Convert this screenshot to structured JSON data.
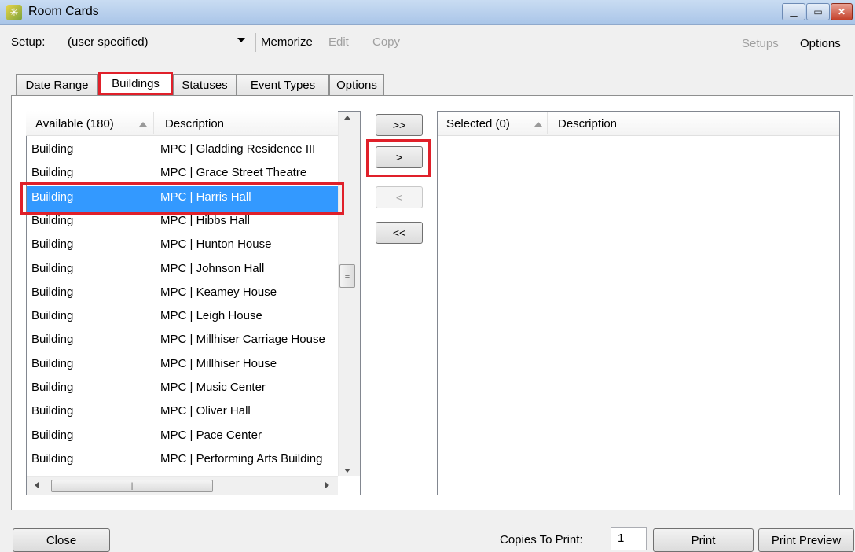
{
  "window": {
    "title": "Room Cards"
  },
  "toolbar": {
    "setup_label": "Setup:",
    "setup_value": "(user specified)",
    "memorize": "Memorize",
    "edit": "Edit",
    "copy": "Copy",
    "setups": "Setups",
    "options": "Options"
  },
  "tabs": [
    {
      "label": "Date Range"
    },
    {
      "label": "Buildings",
      "active": true
    },
    {
      "label": "Statuses"
    },
    {
      "label": "Event Types"
    },
    {
      "label": "Options"
    }
  ],
  "available": {
    "header_col1": "Available (180)",
    "header_col2": "Description",
    "rows": [
      {
        "type": "Building",
        "desc": "MPC | Gladding Residence III"
      },
      {
        "type": "Building",
        "desc": "MPC | Grace Street Theatre"
      },
      {
        "type": "Building",
        "desc": "MPC | Harris Hall",
        "selected": true
      },
      {
        "type": "Building",
        "desc": "MPC | Hibbs Hall"
      },
      {
        "type": "Building",
        "desc": "MPC | Hunton House"
      },
      {
        "type": "Building",
        "desc": "MPC | Johnson Hall"
      },
      {
        "type": "Building",
        "desc": "MPC | Keamey House"
      },
      {
        "type": "Building",
        "desc": "MPC | Leigh House"
      },
      {
        "type": "Building",
        "desc": "MPC | Millhiser Carriage House"
      },
      {
        "type": "Building",
        "desc": "MPC | Millhiser House"
      },
      {
        "type": "Building",
        "desc": "MPC | Music Center"
      },
      {
        "type": "Building",
        "desc": "MPC | Oliver Hall"
      },
      {
        "type": "Building",
        "desc": "MPC | Pace Center"
      },
      {
        "type": "Building",
        "desc": "MPC | Performing Arts Building"
      }
    ]
  },
  "move_buttons": {
    "add_all": ">>",
    "add": ">",
    "remove": "<",
    "remove_all": "<<"
  },
  "selected": {
    "header_col1": "Selected (0)",
    "header_col2": "Description"
  },
  "bottom": {
    "close": "Close",
    "copies_label": "Copies To Print:",
    "copies_value": "1",
    "print": "Print",
    "print_preview": "Print Preview"
  },
  "colors": {
    "selection": "#3399ff",
    "highlight_outline": "#e0202a"
  }
}
